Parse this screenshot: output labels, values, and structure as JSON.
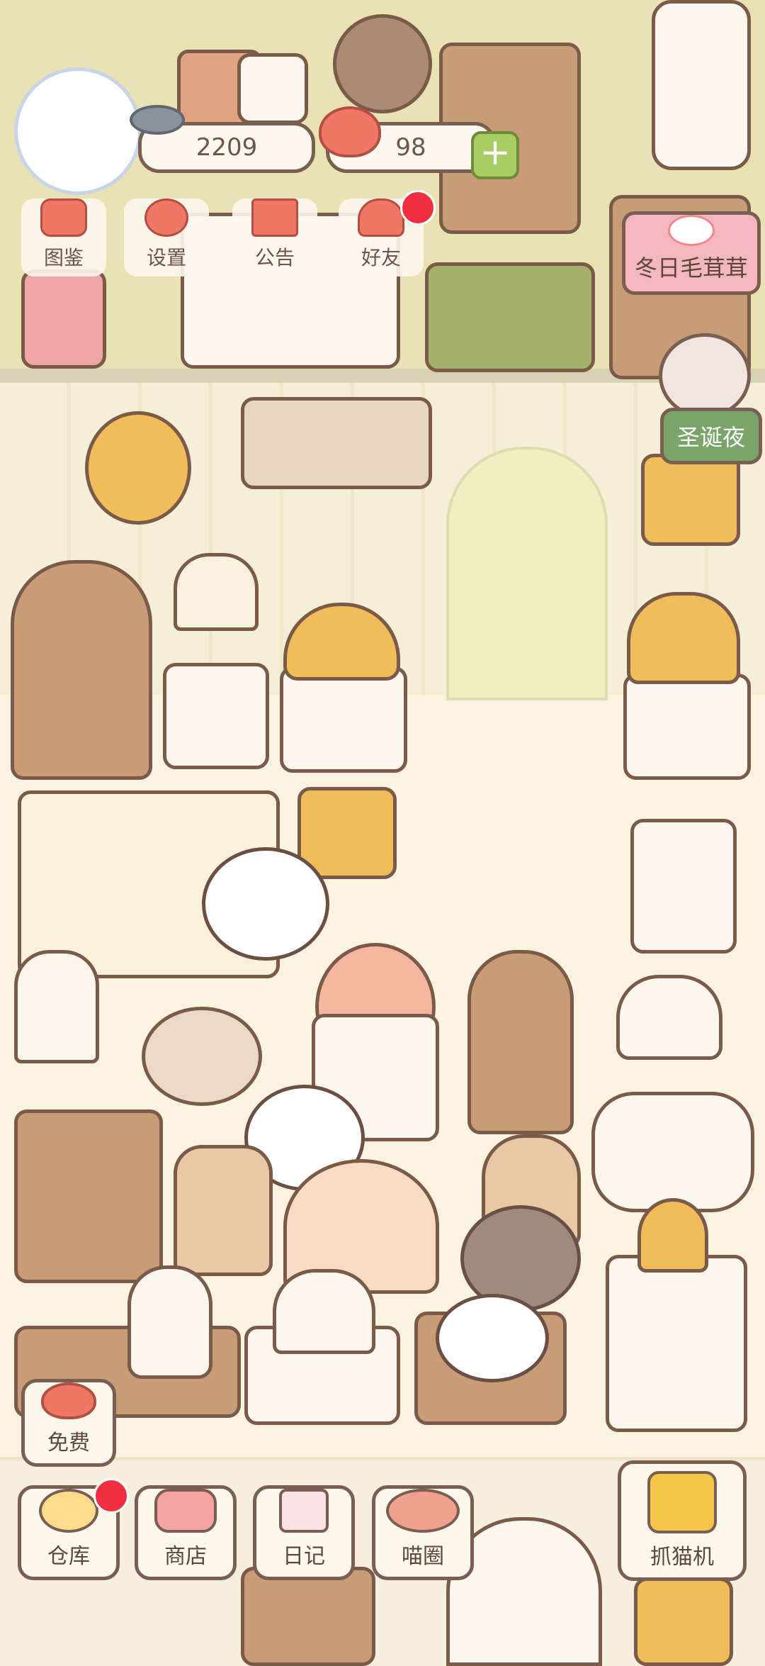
{
  "hud": {
    "fish_count": "2209",
    "heart_count": "98"
  },
  "top_menu": [
    {
      "label": "图鉴",
      "icon": "cat-book-icon"
    },
    {
      "label": "设置",
      "icon": "gear-icon"
    },
    {
      "label": "公告",
      "icon": "gift-icon"
    },
    {
      "label": "好友",
      "icon": "friend-icon",
      "badge": true
    }
  ],
  "events": {
    "winter_label": "冬日毛茸茸",
    "christmas_label": "圣诞夜"
  },
  "side": {
    "free_label": "免费",
    "claw_label": "抓猫机"
  },
  "bottom_nav": [
    {
      "label": "仓库",
      "icon": "warehouse-icon",
      "badge": true
    },
    {
      "label": "商店",
      "icon": "shop-icon"
    },
    {
      "label": "日记",
      "icon": "diary-icon"
    },
    {
      "label": "喵圈",
      "icon": "cat-circle-icon"
    }
  ],
  "colors": {
    "accent_red": "#ef2f3f",
    "outline_brown": "#7b5e52",
    "event_green": "#7aa56a",
    "event_pink": "#f3b7bf"
  }
}
